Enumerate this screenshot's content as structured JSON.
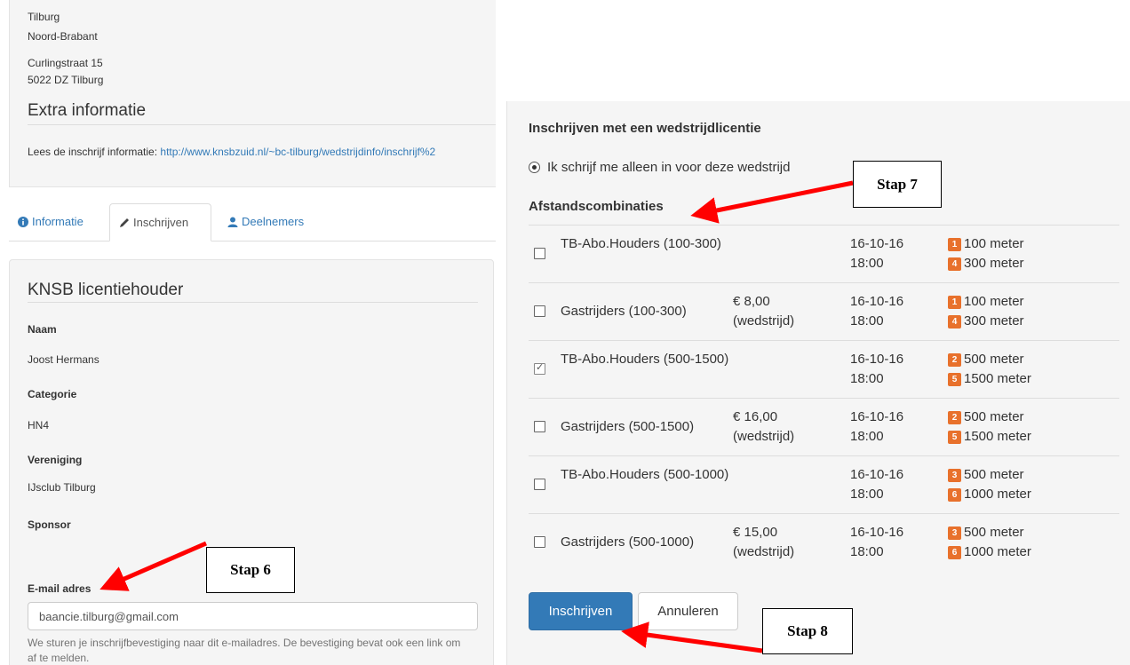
{
  "left": {
    "address": {
      "city": "Tilburg",
      "province": "Noord-Brabant",
      "street": "Curlingstraat 15",
      "postal": "5022 DZ Tilburg"
    },
    "extra_title": "Extra informatie",
    "info_prefix": "Lees de inschrijf informatie: ",
    "info_link": "http://www.knsbzuid.nl/~bc-tilburg/wedstrijdinfo/inschrijf%2",
    "tabs": [
      {
        "label": "Informatie",
        "icon": "info-icon"
      },
      {
        "label": "Inschrijven",
        "icon": "pencil-icon"
      },
      {
        "label": "Deelnemers",
        "icon": "user-icon"
      }
    ],
    "panel_title": "KNSB licentiehouder",
    "fields": {
      "naam_label": "Naam",
      "naam_value": "Joost Hermans",
      "categorie_label": "Categorie",
      "categorie_value": "HN4",
      "vereniging_label": "Vereniging",
      "vereniging_value": "IJsclub Tilburg",
      "sponsor_label": "Sponsor",
      "email_label": "E-mail adres",
      "email_value": "baancie.tilburg@gmail.com"
    },
    "help_text": "We sturen je inschrijfbevestiging naar dit e-mailadres. De bevestiging bevat ook een link om af te melden."
  },
  "right": {
    "title": "Inschrijven met een wedstrijdlicentie",
    "radio_label": "Ik schrijf me alleen in voor deze wedstrijd",
    "combos_title": "Afstandscombinaties",
    "rows": [
      {
        "name": "TB-Abo.Houders (100-300)",
        "price": "",
        "price_note": "",
        "date": "16-10-16",
        "time": "18:00",
        "checked": false,
        "distances": [
          {
            "n": "1",
            "label": "100 meter"
          },
          {
            "n": "4",
            "label": "300 meter"
          }
        ]
      },
      {
        "name": "Gastrijders (100-300)",
        "price": "€ 8,00",
        "price_note": "(wedstrijd)",
        "date": "16-10-16",
        "time": "18:00",
        "checked": false,
        "distances": [
          {
            "n": "1",
            "label": "100 meter"
          },
          {
            "n": "4",
            "label": "300 meter"
          }
        ]
      },
      {
        "name": "TB-Abo.Houders (500-1500)",
        "price": "",
        "price_note": "",
        "date": "16-10-16",
        "time": "18:00",
        "checked": true,
        "distances": [
          {
            "n": "2",
            "label": "500 meter"
          },
          {
            "n": "5",
            "label": "1500 meter"
          }
        ]
      },
      {
        "name": "Gastrijders (500-1500)",
        "price": "€ 16,00",
        "price_note": "(wedstrijd)",
        "date": "16-10-16",
        "time": "18:00",
        "checked": false,
        "distances": [
          {
            "n": "2",
            "label": "500 meter"
          },
          {
            "n": "5",
            "label": "1500 meter"
          }
        ]
      },
      {
        "name": "TB-Abo.Houders (500-1000)",
        "price": "",
        "price_note": "",
        "date": "16-10-16",
        "time": "18:00",
        "checked": false,
        "distances": [
          {
            "n": "3",
            "label": "500 meter"
          },
          {
            "n": "6",
            "label": "1000 meter"
          }
        ]
      },
      {
        "name": "Gastrijders (500-1000)",
        "price": "€ 15,00",
        "price_note": "(wedstrijd)",
        "date": "16-10-16",
        "time": "18:00",
        "checked": false,
        "distances": [
          {
            "n": "3",
            "label": "500 meter"
          },
          {
            "n": "6",
            "label": "1000 meter"
          }
        ]
      }
    ],
    "submit_label": "Inschrijven",
    "cancel_label": "Annuleren"
  },
  "annotations": {
    "stap6": "Stap 6",
    "stap7": "Stap 7",
    "stap8": "Stap 8"
  },
  "colors": {
    "link": "#337ab7",
    "primary_button": "#337ab7",
    "badge": "#e8712c",
    "arrow": "#ff0000",
    "well_bg": "#f5f5f5"
  }
}
